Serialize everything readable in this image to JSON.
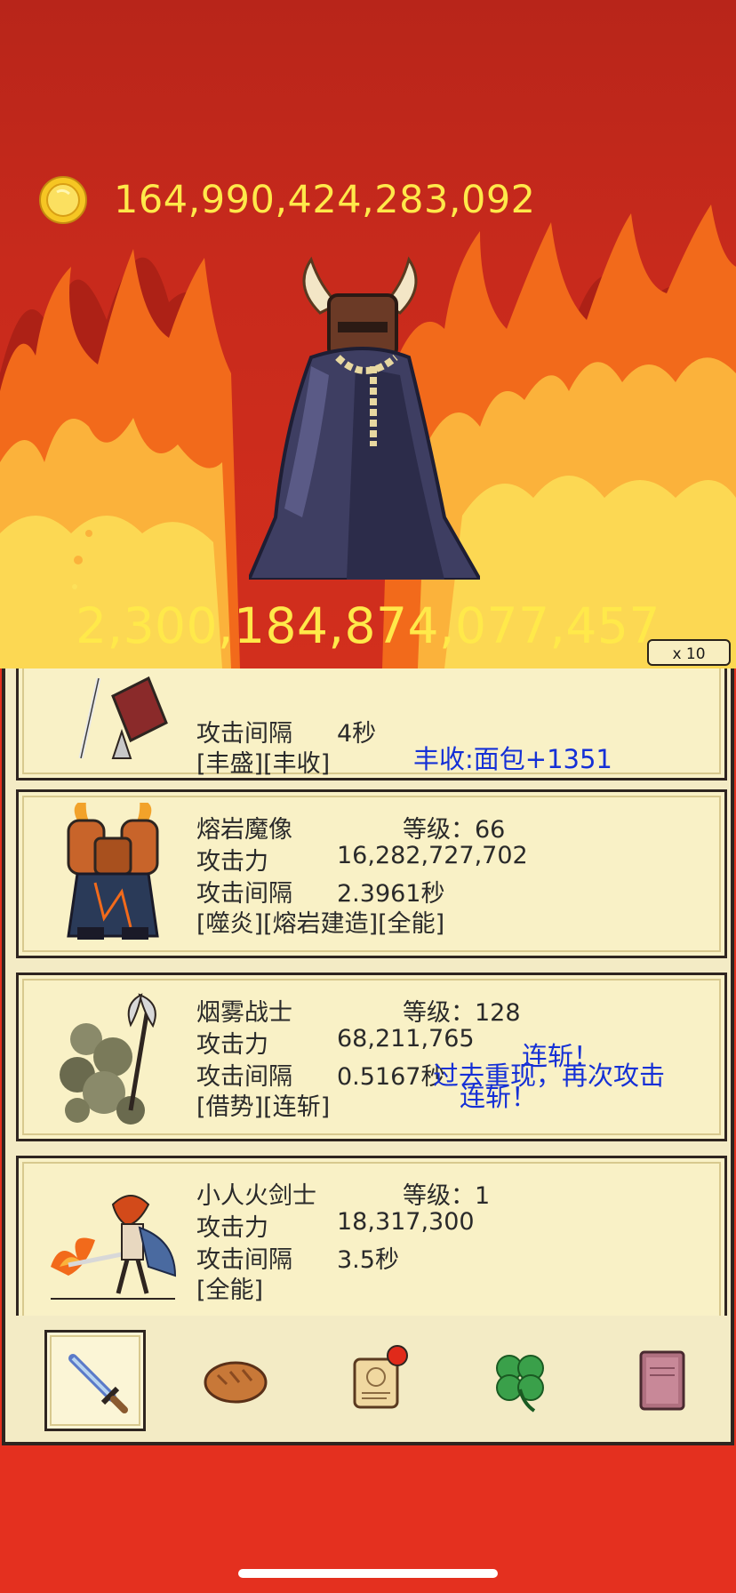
{
  "header": {
    "coin_icon": "gold-coin-icon",
    "gold_amount": "164,990,424,283,092",
    "boss_hp": "2,300,184,874,077,457",
    "multiplier": "x 10"
  },
  "colors": {
    "gold_text": "#ffe94a",
    "panel_bg": "#f3ebc5",
    "float_text": "#1530d6",
    "background": "#e4301f"
  },
  "units": [
    {
      "portrait_icon": "wizard-staff-icon",
      "interval_label": "攻击间隔",
      "interval_value": "4秒",
      "traits": "[丰盛][丰收]",
      "float_texts": [
        "丰收:面包+1351"
      ]
    },
    {
      "portrait_icon": "lava-golem-icon",
      "name": "熔岩魔像",
      "level": "等级：66",
      "attack_label": "攻击力",
      "attack_value": "16,282,727,702",
      "interval_label": "攻击间隔",
      "interval_value": "2.3961秒",
      "traits": "[噬炎][熔岩建造][全能]",
      "float_texts": []
    },
    {
      "portrait_icon": "smoke-warrior-icon",
      "name": "烟雾战士",
      "level": "等级：128",
      "attack_label": "攻击力",
      "attack_value": "68,211,765",
      "interval_label": "攻击间隔",
      "interval_value": "0.5167秒",
      "traits": "[借势][连斩]",
      "float_texts": [
        "连斩！",
        "过去重现，再次攻击",
        "连斩！"
      ]
    },
    {
      "portrait_icon": "fire-swordsman-icon",
      "name": "小人火剑士",
      "level": "等级：1",
      "attack_label": "攻击力",
      "attack_value": "18,317,300",
      "interval_label": "攻击间隔",
      "interval_value": "3.5秒",
      "traits": "[全能]",
      "float_texts": []
    }
  ],
  "tabs": [
    {
      "icon": "sword-icon",
      "active": true
    },
    {
      "icon": "bread-icon",
      "active": false
    },
    {
      "icon": "scroll-icon",
      "active": false,
      "badge": true
    },
    {
      "icon": "clover-icon",
      "active": false
    },
    {
      "icon": "book-icon",
      "active": false
    }
  ]
}
